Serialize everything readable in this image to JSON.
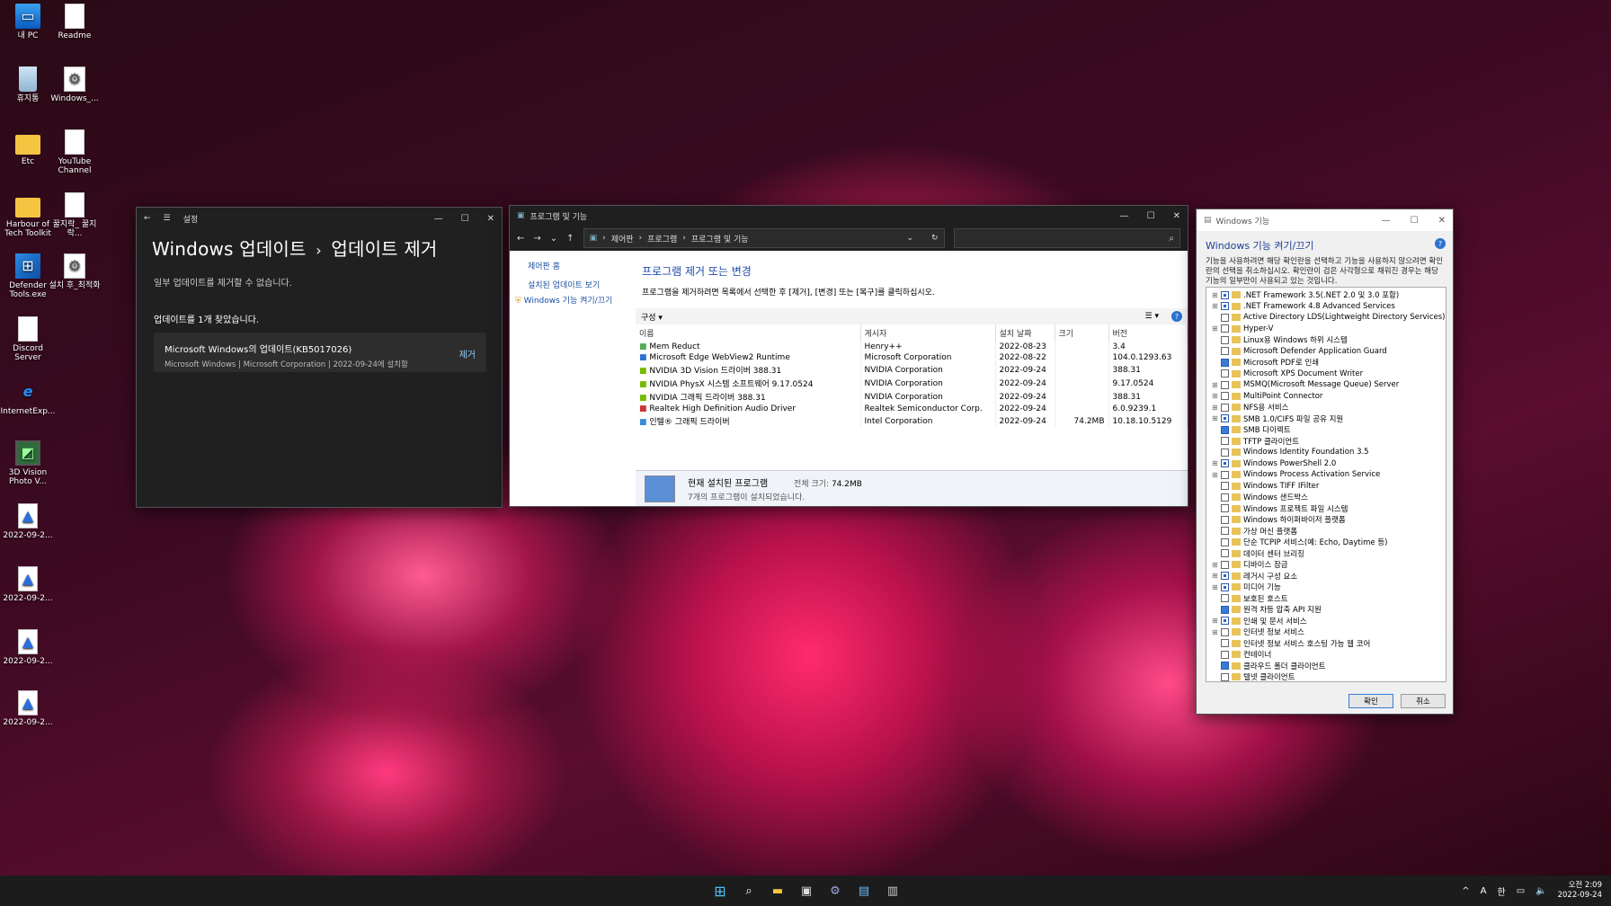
{
  "desktop": {
    "icons": [
      {
        "label": "내 PC",
        "icon": "computer-icon"
      },
      {
        "label": "Readme",
        "icon": "document-icon"
      },
      {
        "label": "휴지통",
        "icon": "recycle-bin-icon"
      },
      {
        "label": "Windows_...",
        "icon": "settings-file-icon"
      },
      {
        "label": "Etc",
        "icon": "folder-icon"
      },
      {
        "label": "YouTube Channel",
        "icon": "document-icon"
      },
      {
        "label": "Harbour of Tech Toolkit",
        "icon": "folder-icon"
      },
      {
        "label": "꿀지락_ 꿀지락...",
        "icon": "document-icon"
      },
      {
        "label": "Defender Tools.exe",
        "icon": "defender-icon"
      },
      {
        "label": "설치 후_최적화",
        "icon": "settings-file-icon"
      },
      {
        "label": "Discord Server",
        "icon": "document-icon"
      },
      {
        "label": "InternetExp...",
        "icon": "internet-explorer-icon"
      },
      {
        "label": "3D Vision Photo V...",
        "icon": "3d-vision-icon"
      },
      {
        "label": "2022-09-2...",
        "icon": "image-file-icon"
      },
      {
        "label": "2022-09-2...",
        "icon": "image-file-icon"
      },
      {
        "label": "2022-09-2...",
        "icon": "image-file-icon"
      },
      {
        "label": "2022-09-2...",
        "icon": "image-file-icon"
      }
    ]
  },
  "settings": {
    "app": "설정",
    "title_a": "Windows 업데이트",
    "sep": "›",
    "title_b": "업데이트 제거",
    "subtitle": "일부 업데이트를 제거할 수 없습니다.",
    "found": "업데이트를 1개 찾았습니다.",
    "update": {
      "name": "Microsoft Windows의 업데이트(KB5017026)",
      "meta": "Microsoft Windows  |  Microsoft Corporation  |  2022-09-24에 설치함",
      "action": "제거"
    }
  },
  "programs": {
    "title": "프로그램 및 기능",
    "breadcrumb": [
      "제어판",
      "프로그램",
      "프로그램 및 기능"
    ],
    "left": {
      "home": "제어판 홈",
      "installed_updates": "설치된 업데이트 보기",
      "features": "Windows 기능 켜기/끄기"
    },
    "heading": "프로그램 제거 또는 변경",
    "desc": "프로그램을 제거하려면 목록에서 선택한 후 [제거], [변경] 또는 [복구]를 클릭하십시오.",
    "organize": "구성 ▾",
    "columns": [
      "이름",
      "게시자",
      "설치 날짜",
      "크기",
      "버전"
    ],
    "rows": [
      {
        "name": "Mem Reduct",
        "publisher": "Henry++",
        "date": "2022-08-23",
        "size": "",
        "version": "3.4"
      },
      {
        "name": "Microsoft Edge WebView2 Runtime",
        "publisher": "Microsoft Corporation",
        "date": "2022-08-22",
        "size": "",
        "version": "104.0.1293.63"
      },
      {
        "name": "NVIDIA 3D Vision 드라이버 388.31",
        "publisher": "NVIDIA Corporation",
        "date": "2022-09-24",
        "size": "",
        "version": "388.31"
      },
      {
        "name": "NVIDIA PhysX 시스템 소프트웨어 9.17.0524",
        "publisher": "NVIDIA Corporation",
        "date": "2022-09-24",
        "size": "",
        "version": "9.17.0524"
      },
      {
        "name": "NVIDIA 그래픽 드라이버 388.31",
        "publisher": "NVIDIA Corporation",
        "date": "2022-09-24",
        "size": "",
        "version": "388.31"
      },
      {
        "name": "Realtek High Definition Audio Driver",
        "publisher": "Realtek Semiconductor Corp.",
        "date": "2022-09-24",
        "size": "",
        "version": "6.0.9239.1"
      },
      {
        "name": "인텔® 그래픽 드라이버",
        "publisher": "Intel Corporation",
        "date": "2022-09-24",
        "size": "74.2MB",
        "version": "10.18.10.5129"
      }
    ],
    "footer": {
      "label": "현재 설치된 프로그램",
      "total_label": "전체 크기:",
      "total": "74.2MB",
      "count": "7개의 프로그램이 설치되었습니다."
    }
  },
  "features": {
    "title": "Windows 기능",
    "heading": "Windows 기능 켜기/끄기",
    "desc": "기능을 사용하려면 해당 확인란을 선택하고 기능을 사용하지 않으려면 확인란의 선택을 취소하십시오. 확인란이 검은 사각형으로 채워진 경우는 해당 기능의 일부만이 사용되고 있는 것입니다.",
    "items": [
      {
        "label": ".NET Framework 3.5(.NET 2.0 및 3.0 포함)",
        "exp": true,
        "state": "part"
      },
      {
        "label": ".NET Framework 4.8 Advanced Services",
        "exp": true,
        "state": "part"
      },
      {
        "label": "Active Directory LDS(Lightweight Directory Services)",
        "exp": false,
        "state": "off"
      },
      {
        "label": "Hyper-V",
        "exp": true,
        "state": "off"
      },
      {
        "label": "Linux용 Windows 하위 시스템",
        "exp": false,
        "state": "off"
      },
      {
        "label": "Microsoft Defender Application Guard",
        "exp": false,
        "state": "off"
      },
      {
        "label": "Microsoft PDF로 인쇄",
        "exp": false,
        "state": "on"
      },
      {
        "label": "Microsoft XPS Document Writer",
        "exp": false,
        "state": "off"
      },
      {
        "label": "MSMQ(Microsoft Message Queue) Server",
        "exp": true,
        "state": "off"
      },
      {
        "label": "MultiPoint Connector",
        "exp": true,
        "state": "off"
      },
      {
        "label": "NFS용 서비스",
        "exp": true,
        "state": "off"
      },
      {
        "label": "SMB 1.0/CIFS 파일 공유 지원",
        "exp": true,
        "state": "part"
      },
      {
        "label": "SMB 다이렉트",
        "exp": false,
        "state": "on"
      },
      {
        "label": "TFTP 클라이언트",
        "exp": false,
        "state": "off"
      },
      {
        "label": "Windows Identity Foundation 3.5",
        "exp": false,
        "state": "off"
      },
      {
        "label": "Windows PowerShell 2.0",
        "exp": true,
        "state": "part"
      },
      {
        "label": "Windows Process Activation Service",
        "exp": true,
        "state": "off"
      },
      {
        "label": "Windows TIFF IFilter",
        "exp": false,
        "state": "off"
      },
      {
        "label": "Windows 샌드박스",
        "exp": false,
        "state": "off"
      },
      {
        "label": "Windows 프로젝트 파일 시스템",
        "exp": false,
        "state": "off"
      },
      {
        "label": "Windows 하이퍼바이저 플랫폼",
        "exp": false,
        "state": "off"
      },
      {
        "label": "가상 머신 플랫폼",
        "exp": false,
        "state": "off"
      },
      {
        "label": "단순 TCPIP 서비스(예: Echo, Daytime 등)",
        "exp": false,
        "state": "off"
      },
      {
        "label": "데이터 센터 브리징",
        "exp": false,
        "state": "off"
      },
      {
        "label": "디바이스 잠금",
        "exp": true,
        "state": "off"
      },
      {
        "label": "레거시 구성 요소",
        "exp": true,
        "state": "part"
      },
      {
        "label": "미디어 기능",
        "exp": true,
        "state": "part"
      },
      {
        "label": "보호된 호스트",
        "exp": false,
        "state": "off"
      },
      {
        "label": "원격 차등 압축 API 지원",
        "exp": false,
        "state": "on"
      },
      {
        "label": "인쇄 및 문서 서비스",
        "exp": true,
        "state": "part"
      },
      {
        "label": "인터넷 정보 서비스",
        "exp": true,
        "state": "off"
      },
      {
        "label": "인터넷 정보 서비스 호스팅 가능 웹 코어",
        "exp": false,
        "state": "off"
      },
      {
        "label": "컨테이너",
        "exp": false,
        "state": "off"
      },
      {
        "label": "클라우드 폴더 클라이언트",
        "exp": false,
        "state": "on"
      },
      {
        "label": "텔넷 클라이언트",
        "exp": false,
        "state": "off"
      }
    ],
    "ok": "확인",
    "cancel": "취소"
  },
  "taskbar": {
    "apps": [
      "start-icon",
      "search-icon",
      "file-explorer-icon",
      "store-icon",
      "settings-icon",
      "control-panel-icon",
      "features-icon"
    ],
    "tray": {
      "lang": "A",
      "ime": "한",
      "time": "오전 2:09",
      "date": "2022-09-24"
    }
  },
  "colors": {
    "accent": "#0067c0",
    "link": "#1e4aa8"
  }
}
